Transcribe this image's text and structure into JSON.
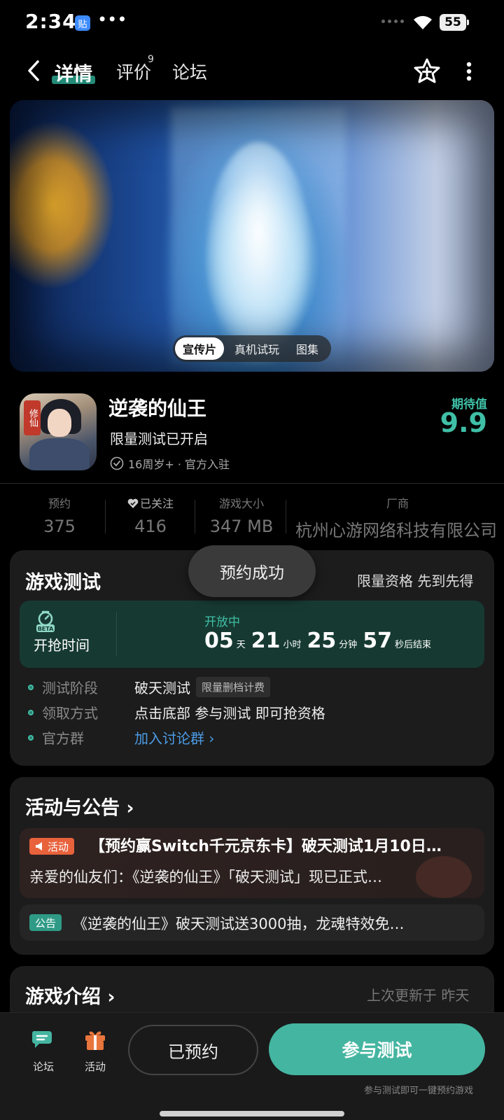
{
  "status_bar": {
    "time": "2:34",
    "app_badge": "贴",
    "extra": "•••",
    "battery": "55"
  },
  "nav": {
    "tabs": [
      {
        "label": "详情"
      },
      {
        "label": "评价"
      },
      {
        "label": "论坛"
      }
    ],
    "reviews_count": "9"
  },
  "media": {
    "tabs": [
      "宣传片",
      "真机试玩",
      "图集"
    ]
  },
  "game": {
    "icon_text": "修仙",
    "title": "逆袭的仙王",
    "subtitle": "限量测试已开启",
    "meta": "16周岁+ · 官方入驻",
    "expect_label": "期待值",
    "expect_score": "9.9"
  },
  "stats": [
    {
      "label": "预约",
      "value": "375"
    },
    {
      "label": "已关注",
      "value": "416"
    },
    {
      "label": "游戏大小",
      "value": "347 MB"
    },
    {
      "label": "厂商",
      "value": "杭州心游网络科技有限公司"
    }
  ],
  "game_test": {
    "title": "游戏测试",
    "right": "限量资格 先到先得",
    "beta_badge": "BETA",
    "grab_label": "开抢时间",
    "open_status": "开放中",
    "countdown": {
      "days": "05",
      "days_unit": "天",
      "hours": "21",
      "hours_unit": "小时",
      "minutes": "25",
      "minutes_unit": "分钟",
      "seconds": "57",
      "seconds_unit": "秒后结束"
    },
    "rows": [
      {
        "key": "测试阶段",
        "value": "破天测试",
        "tag": "限量删档计费"
      },
      {
        "key": "领取方式",
        "value": "点击底部 参与测试 即可抢资格"
      },
      {
        "key": "官方群",
        "value": "加入讨论群 ›"
      }
    ]
  },
  "toast": "预约成功",
  "activities": {
    "title": "活动与公告 ›",
    "items": [
      {
        "badge": "活动",
        "title": "【预约赢Switch千元京东卡】破天测试1月10日…",
        "desc": "亲爱的仙友们：《逆袭的仙王》「破天测试」现已正式…"
      },
      {
        "badge": "公告",
        "title": "《逆袭的仙王》破天测试送3000抽，龙魂特效免…"
      }
    ]
  },
  "intro": {
    "title": "游戏介绍 ›",
    "updated": "上次更新于 昨天"
  },
  "bottom_bar": {
    "forum": "论坛",
    "activity": "活动",
    "reserved": "已预约",
    "join": "参与测试",
    "hint": "参与测试即可一键预约游戏"
  },
  "colors": {
    "accent": "#3fbfa6",
    "activity_badge": "#e8623c",
    "link": "#4c9ce6"
  }
}
